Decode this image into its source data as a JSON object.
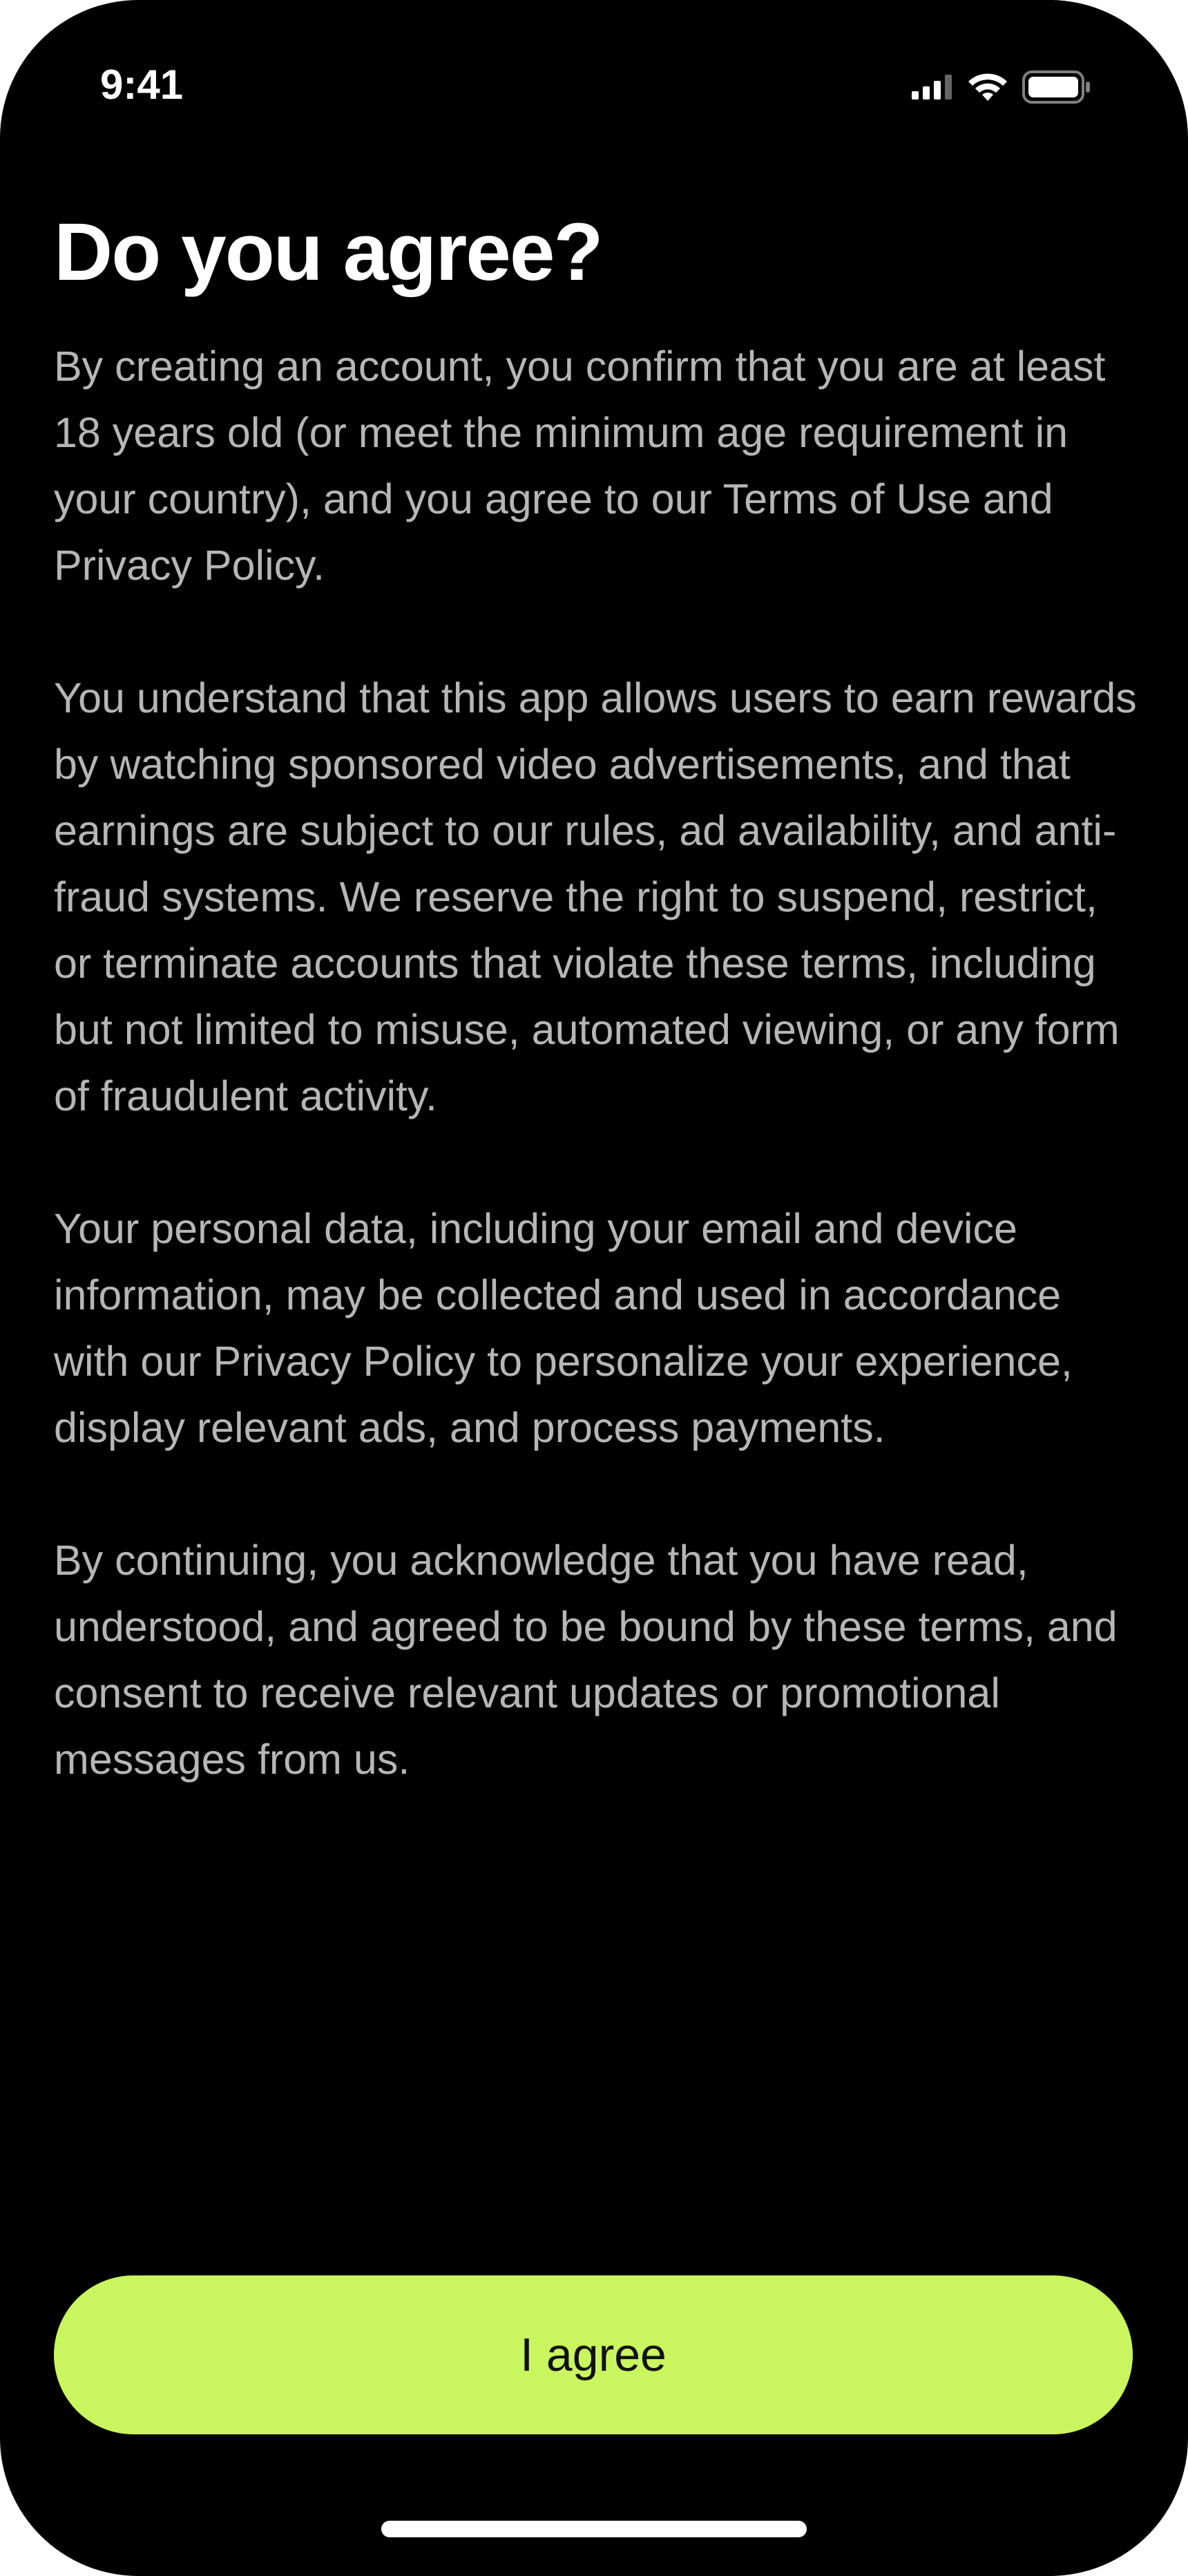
{
  "status_bar": {
    "time": "9:41",
    "icons": [
      "cellular-signal-icon",
      "wifi-icon",
      "battery-icon"
    ]
  },
  "page": {
    "title": "Do you agree?",
    "paragraphs": [
      "By creating an account, you confirm that you are at least 18 years old (or meet the minimum age requirement in your country), and you agree to our Terms of Use and Privacy Policy.",
      "You understand that this app allows users to earn rewards by watching sponsored video advertisements, and that earnings are subject to our rules, ad availability, and anti-fraud systems. We reserve the right to suspend, restrict, or terminate accounts that violate these terms, including but not limited to misuse, automated viewing, or any form of fraudulent activity.",
      "Your personal data, including your email and device information, may be collected and used in accordance with our Privacy Policy to personalize your experience, display relevant ads, and process payments.",
      "By continuing, you acknowledge that you have read, understood, and agreed to be bound by these terms, and consent to receive relevant updates or promotional messages from us."
    ]
  },
  "actions": {
    "agree_label": "I agree"
  },
  "colors": {
    "background": "#000000",
    "title": "#ffffff",
    "body_text": "#b6b6b6",
    "accent": "#c9f55e",
    "button_text": "#111111"
  }
}
